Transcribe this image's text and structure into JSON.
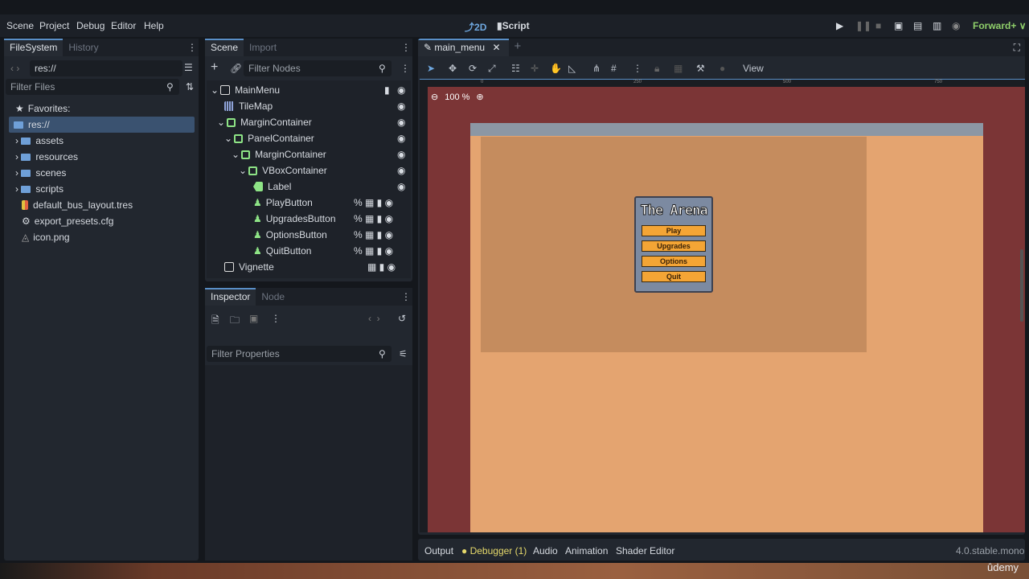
{
  "menu": [
    "Scene",
    "Project",
    "Debug",
    "Editor",
    "Help"
  ],
  "workspaces": {
    "d2": "2D",
    "script": "Script"
  },
  "renderer": "Forward+",
  "filesystem": {
    "tabs": [
      "FileSystem",
      "History"
    ],
    "path": "res://",
    "filter_placeholder": "Filter Files",
    "favorites": "Favorites:",
    "root": "res://",
    "items": [
      "assets",
      "resources",
      "scenes",
      "scripts",
      "default_bus_layout.tres",
      "export_presets.cfg",
      "icon.png"
    ]
  },
  "scene": {
    "tabs": [
      "Scene",
      "Import"
    ],
    "filter_placeholder": "Filter Nodes",
    "nodes": [
      "MainMenu",
      "TileMap",
      "MarginContainer",
      "PanelContainer",
      "MarginContainer",
      "VBoxContainer",
      "Label",
      "PlayButton",
      "UpgradesButton",
      "OptionsButton",
      "QuitButton",
      "Vignette"
    ]
  },
  "inspector": {
    "tabs": [
      "Inspector",
      "Node"
    ],
    "filter_placeholder": "Filter Properties"
  },
  "editor": {
    "tab": "main_menu",
    "view": "View",
    "zoom": "100 %",
    "ruler": [
      "0",
      "250",
      "500",
      "750"
    ]
  },
  "game": {
    "title": "The Arena",
    "buttons": [
      "Play",
      "Upgrades",
      "Options",
      "Quit"
    ]
  },
  "bottom": {
    "tabs": [
      "Output",
      "Debugger (1)",
      "Audio",
      "Animation",
      "Shader Editor"
    ],
    "version": "4.0.stable.mono"
  },
  "watermark": "ûdemy",
  "colors": {
    "accent": "#5a8fc7",
    "control": "#8ee486",
    "debugger": "#e6d96b"
  }
}
